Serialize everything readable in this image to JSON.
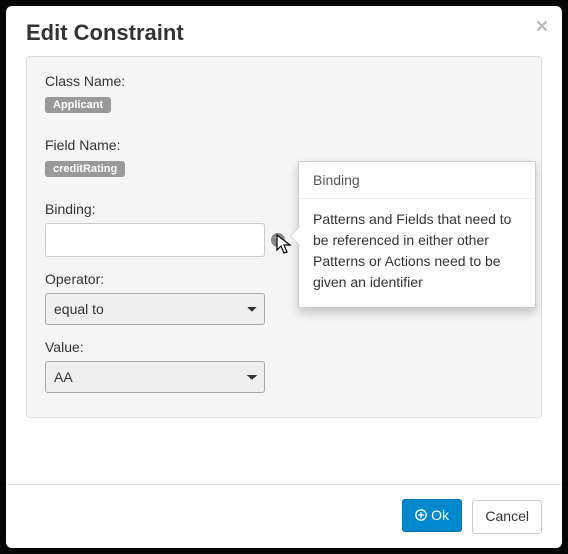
{
  "modal": {
    "title": "Edit Constraint",
    "close_glyph": "×"
  },
  "form": {
    "className": {
      "label": "Class Name:",
      "tag": "Applicant"
    },
    "fieldName": {
      "label": "Field Name:",
      "tag": "creditRating"
    },
    "binding": {
      "label": "Binding:",
      "value": ""
    },
    "operator": {
      "label": "Operator:",
      "value": "equal to"
    },
    "valueField": {
      "label": "Value:",
      "value": "AA"
    }
  },
  "popover": {
    "title": "Binding",
    "body": "Patterns and Fields that need to be referenced in either other Patterns or Actions need to be given an identifier"
  },
  "footer": {
    "ok": "Ok",
    "cancel": "Cancel"
  },
  "icons": {
    "help_glyph": "?"
  }
}
